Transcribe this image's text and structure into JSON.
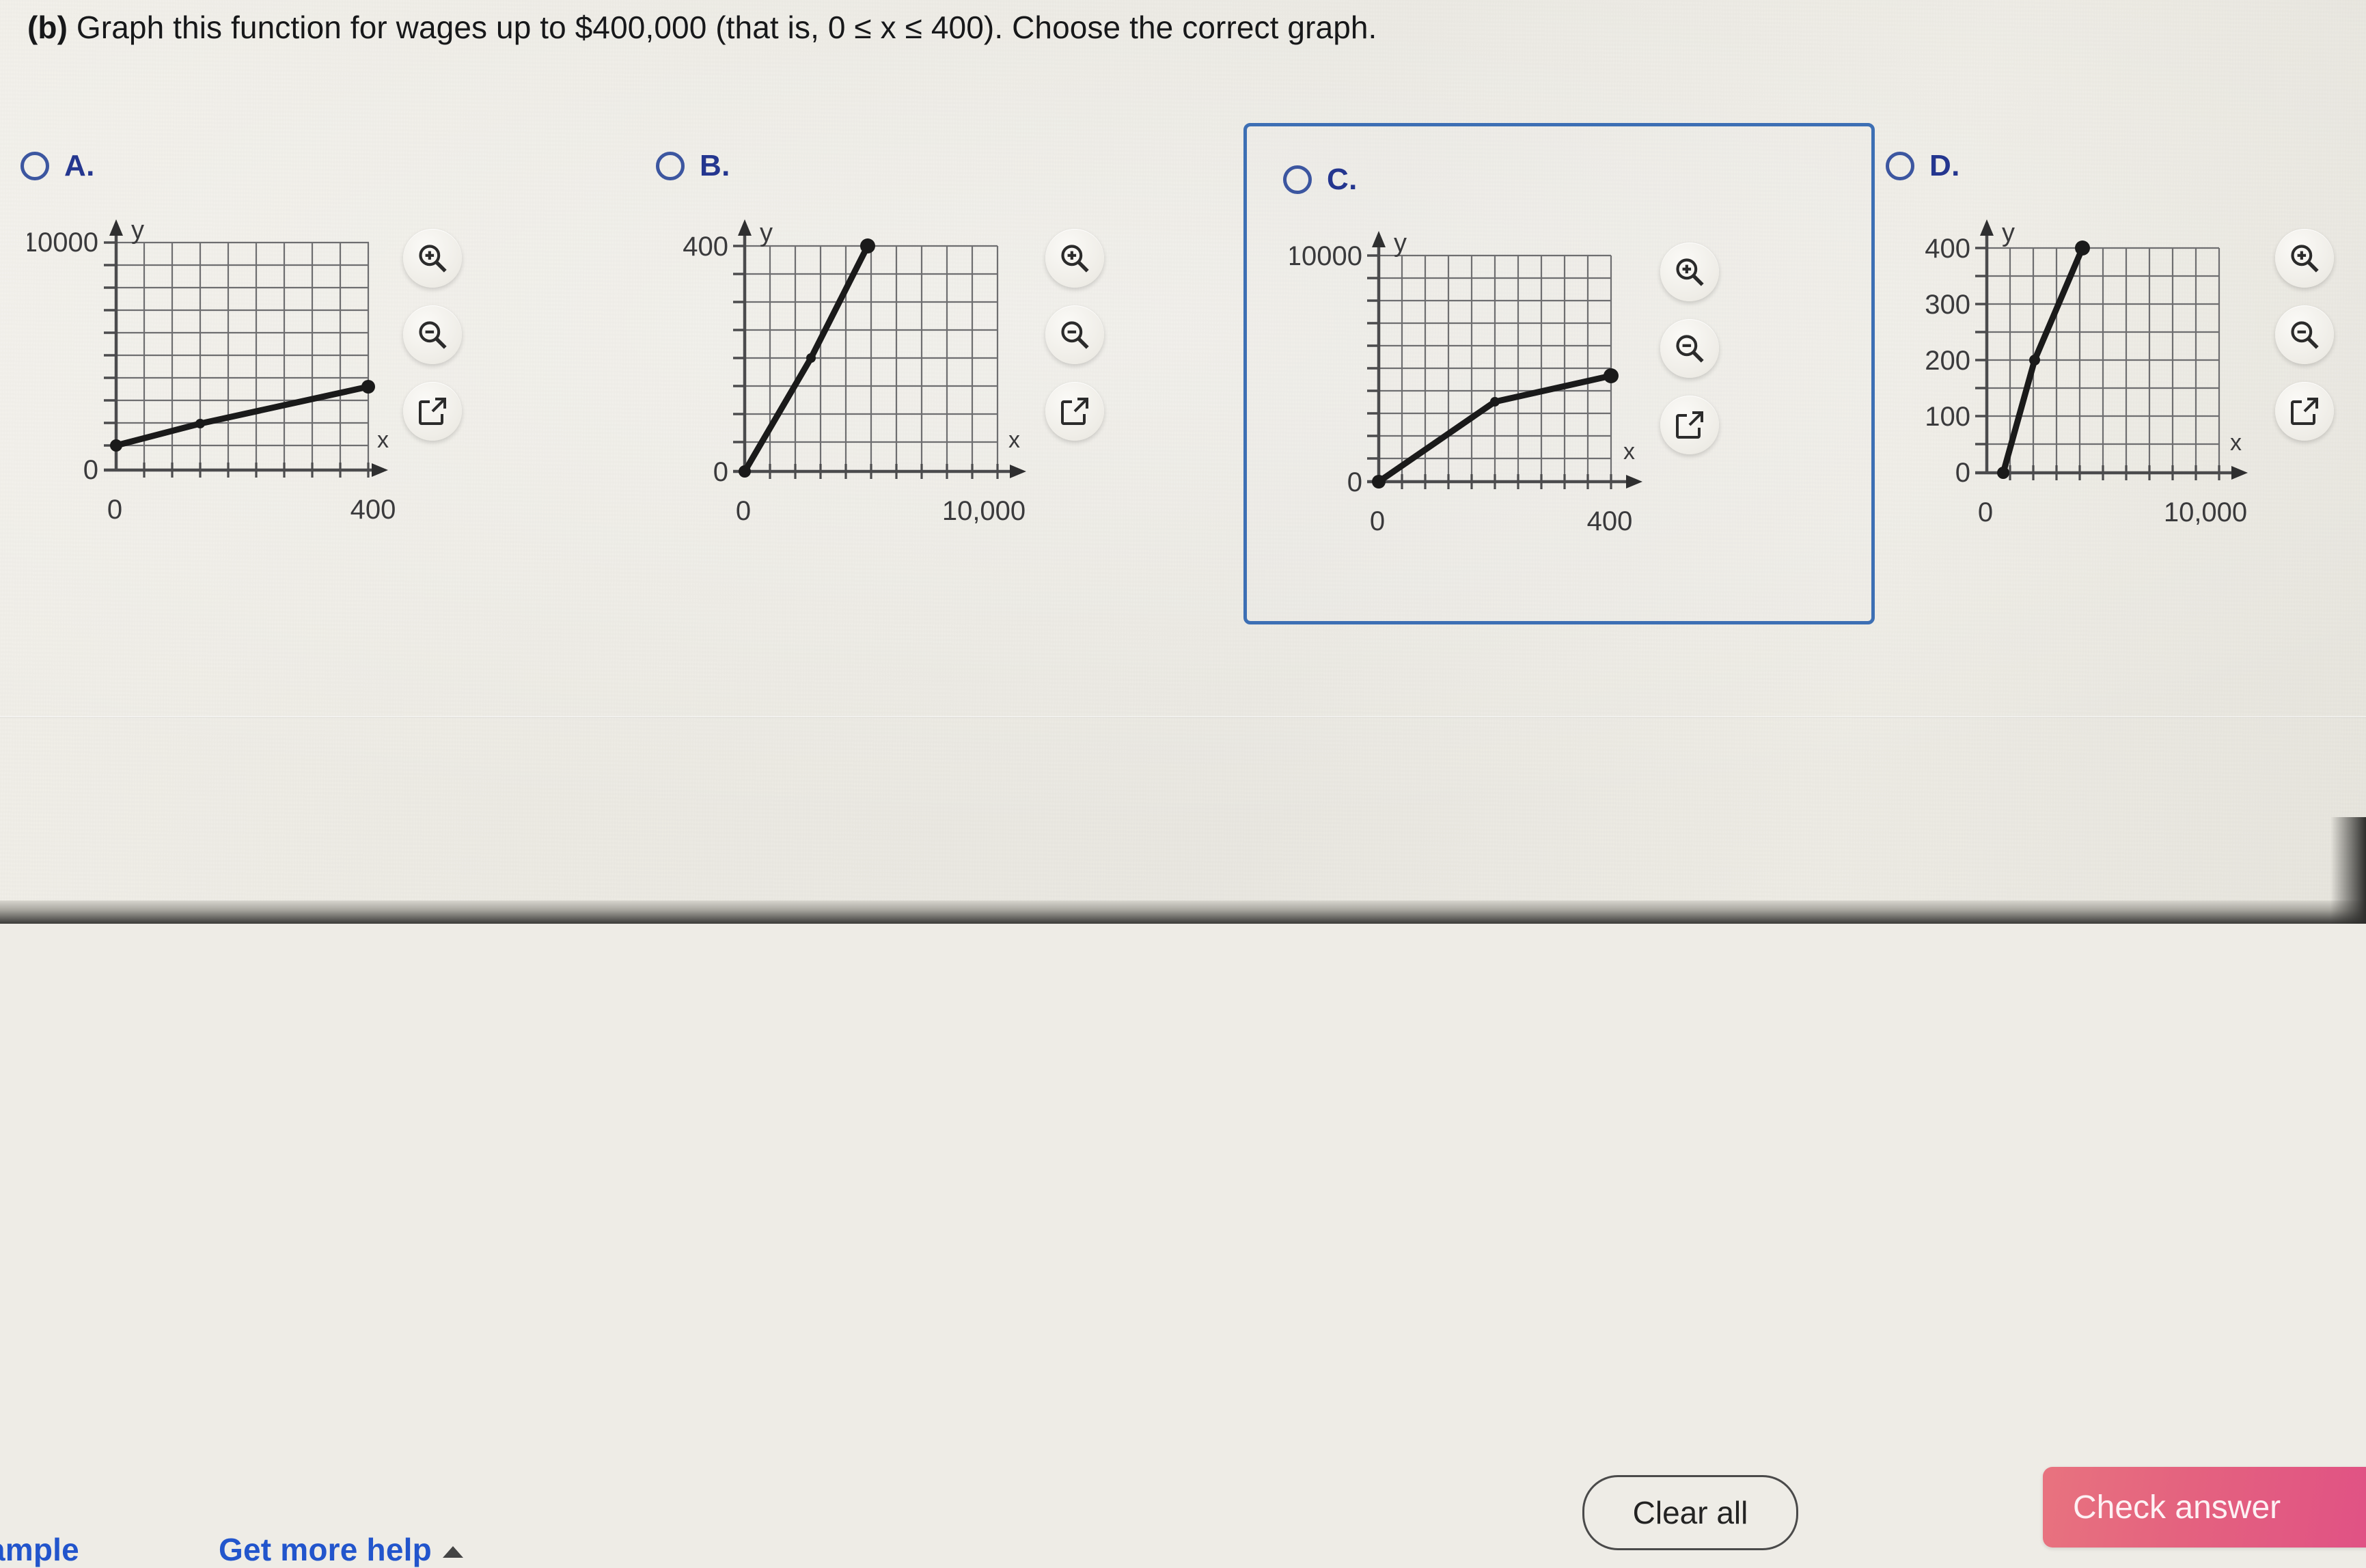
{
  "prompt": {
    "label": "(b)",
    "text": " Graph this function for wages up to $400,000 (that is, 0 ≤ x ≤ 400). Choose the correct graph."
  },
  "choices": [
    {
      "letter": "A.",
      "selected": false,
      "focused": false,
      "chart": {
        "type": "line",
        "title": "",
        "xlabel": "x",
        "ylabel": "y",
        "x_ticks": [
          "0",
          "400"
        ],
        "y_ticks": [
          "10000",
          "0"
        ],
        "xlim": [
          0,
          400
        ],
        "ylim": [
          0,
          10000
        ],
        "grid": true,
        "points": [
          [
            0,
            900
          ],
          [
            133,
            2100
          ],
          [
            400,
            4900
          ]
        ],
        "markers": [
          [
            0,
            900
          ],
          [
            133,
            2100
          ],
          [
            400,
            4900
          ]
        ]
      }
    },
    {
      "letter": "B.",
      "selected": false,
      "focused": false,
      "chart": {
        "type": "line",
        "title": "",
        "xlabel": "x",
        "ylabel": "y",
        "x_ticks": [
          "0",
          "10,000"
        ],
        "y_ticks": [
          "400",
          "0"
        ],
        "xlim": [
          0,
          10000
        ],
        "ylim": [
          0,
          400
        ],
        "grid": true,
        "points": [
          [
            0,
            0
          ],
          [
            2600,
            200
          ],
          [
            5200,
            400
          ]
        ],
        "markers": [
          [
            0,
            0
          ],
          [
            2600,
            200
          ],
          [
            5200,
            400
          ]
        ]
      }
    },
    {
      "letter": "C.",
      "selected": false,
      "focused": true,
      "chart": {
        "type": "line",
        "title": "",
        "xlabel": "x",
        "ylabel": "y",
        "x_ticks": [
          "0",
          "400"
        ],
        "y_ticks": [
          "10000",
          "0"
        ],
        "xlim": [
          0,
          400
        ],
        "ylim": [
          0,
          10000
        ],
        "grid": true,
        "points": [
          [
            0,
            0
          ],
          [
            200,
            2400
          ],
          [
            400,
            4900
          ]
        ],
        "markers": [
          [
            0,
            0
          ],
          [
            200,
            2400
          ],
          [
            400,
            4900
          ]
        ]
      }
    },
    {
      "letter": "D.",
      "selected": false,
      "focused": false,
      "chart": {
        "type": "line",
        "title": "",
        "xlabel": "x",
        "ylabel": "y",
        "x_ticks": [
          "0",
          "10,000"
        ],
        "y_ticks": [
          "400",
          "300",
          "200",
          "100",
          "0"
        ],
        "xlim": [
          0,
          10000
        ],
        "ylim": [
          0,
          400
        ],
        "grid": true,
        "points": [
          [
            700,
            0
          ],
          [
            2100,
            200
          ],
          [
            4200,
            400
          ]
        ],
        "markers": [
          [
            700,
            0
          ],
          [
            2100,
            200
          ],
          [
            4200,
            400
          ]
        ]
      }
    }
  ],
  "tools": {
    "zoom_in": "zoom-in",
    "zoom_out": "zoom-out",
    "expand": "open-in-new"
  },
  "footer": {
    "example_link": "ample",
    "help_link": "Get more help",
    "clear_all": "Clear all",
    "check_answer": "Check answer"
  },
  "colors": {
    "radio_blue": "#3c56a0",
    "letter_blue": "#24368f",
    "focus_border": "#3d6fb4",
    "link_blue": "#2255cc",
    "check_pink": "#df4d86",
    "grid_gray": "#6e6e70",
    "curve_black": "#1a1a1a",
    "page_bg": "#eceae3"
  }
}
